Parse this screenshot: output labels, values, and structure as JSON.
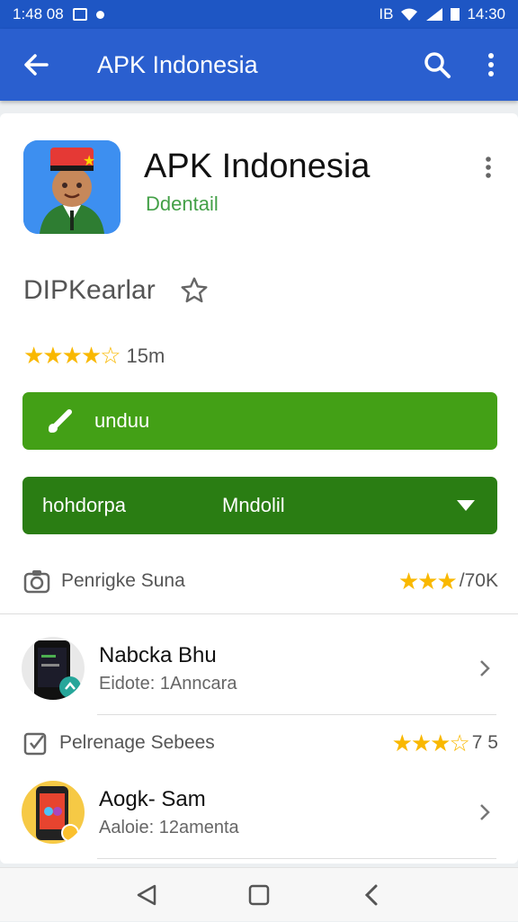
{
  "status_bar": {
    "time_left": "1:48 08",
    "time_right": "14:30",
    "lte_label": "IB"
  },
  "app_bar": {
    "title": "APK Indonesia",
    "back_icon": "arrow-back-icon",
    "search_icon": "search-icon",
    "menu_icon": "more-vert-icon"
  },
  "app": {
    "name": "APK Indonesia",
    "developer": "Ddentail",
    "subtitle": "DIPKearlar",
    "rating_count": "15m",
    "stars": "★★★★☆",
    "colors": {
      "accent": "#43a016",
      "accent_dark": "#2a7d13",
      "appbar": "#2a5fcf",
      "star": "#f9b800"
    }
  },
  "buttons": {
    "primary_label": "unduu",
    "secondary_left": "hohdorpa",
    "secondary_center": "Mndolil"
  },
  "rows": [
    {
      "label": "Penrigke Suna",
      "stars": "★★★",
      "count": "/70K"
    },
    {
      "label": "Pelrenage Sebees",
      "stars": "★★★☆",
      "count": "7 5"
    }
  ],
  "list": [
    {
      "title": "Nabcka Bhu",
      "subtitle": "Eidote: 1Anncara"
    },
    {
      "title": "Aogk- Sam",
      "subtitle": "Aaloie: 12amenta"
    }
  ]
}
